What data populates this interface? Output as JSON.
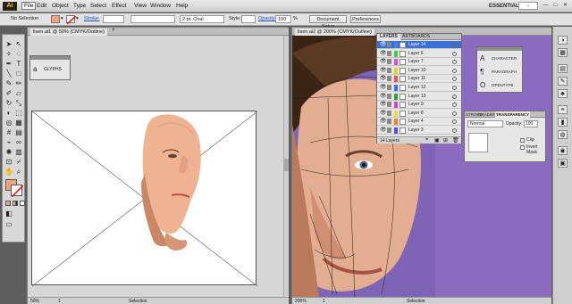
{
  "app": {
    "logo": "Ai"
  },
  "menubar": {
    "items": [
      "File",
      "Edit",
      "Object",
      "Type",
      "Select",
      "Effect",
      "View",
      "Window",
      "Help"
    ],
    "workspace": "ESSENTIALS ▾",
    "search_placeholder": "",
    "win_controls": [
      "—",
      "□",
      "✕"
    ]
  },
  "control": {
    "selection_label": "No Selection",
    "stroke_label": "Stroke:",
    "brush_value": "2 pt. Oval",
    "style_label": "Style:",
    "opacity_label": "Opacity:",
    "opacity_value": "100",
    "percent": "%",
    "doc_setup": "Document Setup",
    "preferences": "Preferences"
  },
  "doc1": {
    "tab": "lisen.ai1 @ 50% (CMYK/Outline)",
    "zoom": "50%",
    "page": "1",
    "status": "Selection"
  },
  "doc2": {
    "tab": "lisen.ai2 @ 200% (CMYK/Outline)",
    "zoom": "200%",
    "page": "1",
    "status": "Selection"
  },
  "layers_panel": {
    "tabs": [
      "LAYERS",
      "ARTBOARDS"
    ],
    "layers": [
      {
        "name": "Layer 14",
        "color": "#4a7cff",
        "selected": true
      },
      {
        "name": "Layer 6",
        "color": "#3bd23b",
        "selected": false
      },
      {
        "name": "Layer 7",
        "color": "#e04ae0",
        "selected": false
      },
      {
        "name": "Layer 10",
        "color": "#d9d922",
        "selected": false
      },
      {
        "name": "Layer 11",
        "color": "#e4554a",
        "selected": false
      },
      {
        "name": "Layer 12",
        "color": "#3c6bff",
        "selected": false
      },
      {
        "name": "Layer 13",
        "color": "#2ea02e",
        "selected": false
      },
      {
        "name": "Layer 9",
        "color": "#d043d0",
        "selected": false
      },
      {
        "name": "Layer 8",
        "color": "#e0e037",
        "selected": false
      },
      {
        "name": "Layer 4",
        "color": "#ff7a2f",
        "selected": false
      },
      {
        "name": "Layer 3",
        "color": "#4d4dff",
        "selected": false
      }
    ],
    "footer": "14 Layers"
  },
  "type_panel": {
    "items": [
      {
        "icon": "A",
        "label": "CHARACTER"
      },
      {
        "icon": "¶",
        "label": "PARAGRAPH"
      },
      {
        "icon": "O",
        "label": "OPENTYPE"
      }
    ]
  },
  "transparency_panel": {
    "tabs": [
      "STROKE",
      "GRADIENT",
      "TRANSPARENCY"
    ],
    "blend_mode": "Normal",
    "opacity_label": "Opacity:",
    "opacity_value": "100",
    "clip_label": "Clip",
    "invert_label": "Invert Mask"
  },
  "glyphs_panel": {
    "label": "GLYPHS"
  },
  "colors": {
    "accent": "#3a6fd3",
    "fill": "#f2a57a",
    "purple_bg": "#8a6bc0"
  }
}
